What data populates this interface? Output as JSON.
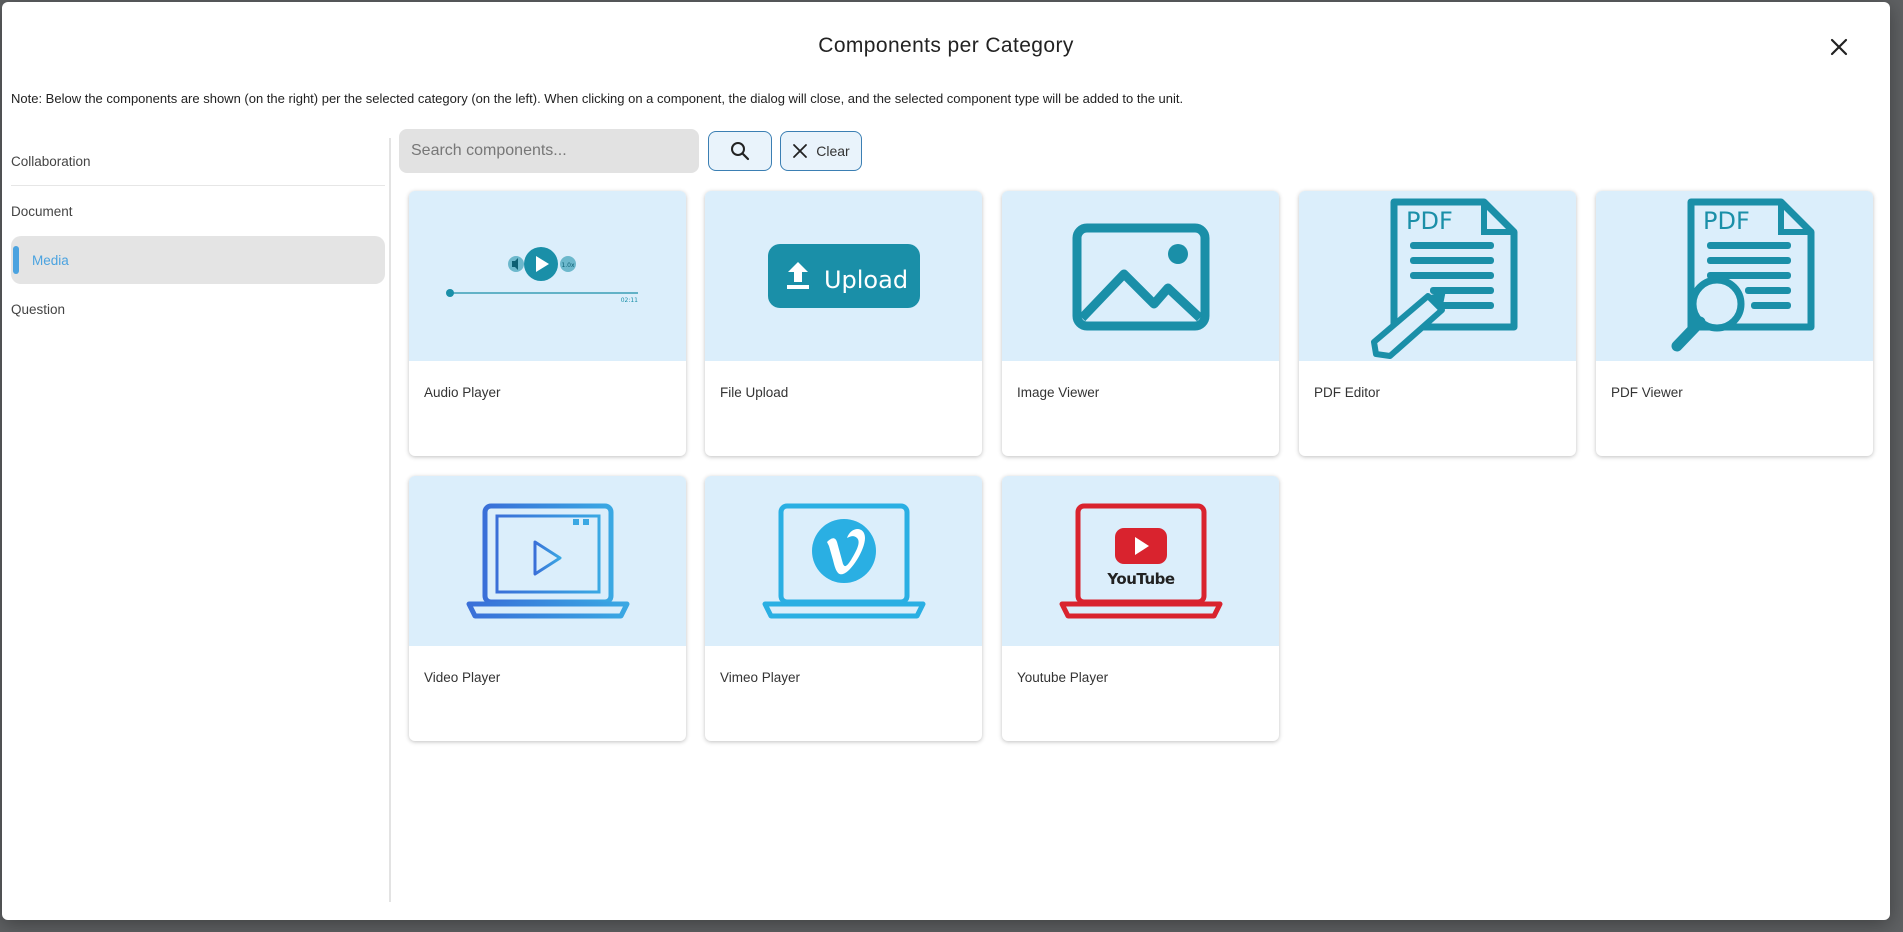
{
  "dialog": {
    "title": "Components per Category",
    "note": "Note: Below the components are shown (on the right) per the selected category (on the left). When clicking on a component, the dialog will close, and the selected component type will be added to the unit."
  },
  "categories": [
    {
      "label": "Collaboration"
    },
    {
      "label": "Document"
    },
    {
      "label": "Media",
      "active": true
    },
    {
      "label": "Question"
    }
  ],
  "search": {
    "placeholder": "Search components...",
    "value": "",
    "search_icon": "search-icon",
    "clear_label": "Clear",
    "clear_icon": "close-icon"
  },
  "components": [
    {
      "label": "Audio Player",
      "icon": "audio-player-icon"
    },
    {
      "label": "File Upload",
      "icon": "upload-icon",
      "icon_text": "Upload"
    },
    {
      "label": "Image Viewer",
      "icon": "image-icon"
    },
    {
      "label": "PDF Editor",
      "icon": "pdf-edit-icon",
      "icon_text": "PDF"
    },
    {
      "label": "PDF Viewer",
      "icon": "pdf-view-icon",
      "icon_text": "PDF"
    },
    {
      "label": "Video Player",
      "icon": "video-laptop-icon"
    },
    {
      "label": "Vimeo Player",
      "icon": "vimeo-laptop-icon"
    },
    {
      "label": "Youtube Player",
      "icon": "youtube-laptop-icon",
      "icon_text": "YouTube"
    }
  ],
  "audio_widget": {
    "time": "02:11"
  },
  "colors": {
    "accent": "#4ba3e0",
    "teal": "#1a8fa8",
    "youtube_red": "#d9232e",
    "card_bg": "#dbeefb",
    "vimeo_blue": "#2aafe3"
  }
}
